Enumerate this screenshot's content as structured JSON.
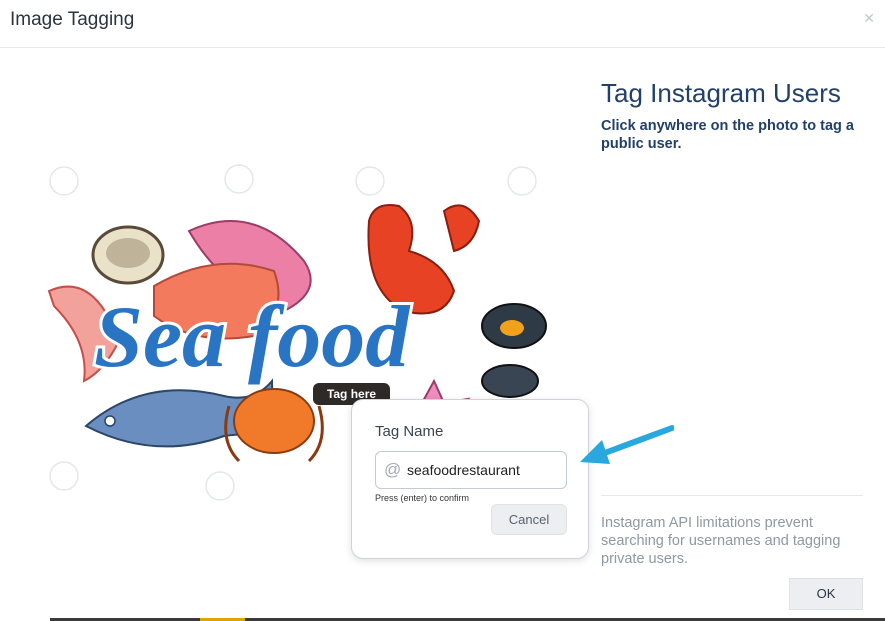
{
  "dialog": {
    "title": "Image Tagging",
    "close_icon": "close-icon"
  },
  "photo": {
    "brand_text": "Sea food",
    "watermark_icon": "chef-hat-icon",
    "tag_marker": "Tag here"
  },
  "tag_popover": {
    "title": "Tag Name",
    "at_symbol": "@",
    "input_value": "seafoodrestaurant",
    "hint": "Press (enter) to confirm",
    "cancel_label": "Cancel"
  },
  "sidebar": {
    "title": "Tag Instagram Users",
    "description": "Click anywhere on the photo to tag a public user.",
    "note": "Instagram API limitations prevent searching for usernames and tagging private users.",
    "ok_label": "OK"
  },
  "colors": {
    "accent_arrow": "#29a8e0",
    "title_text": "#22406a",
    "brand_blue": "#2a74c4"
  }
}
